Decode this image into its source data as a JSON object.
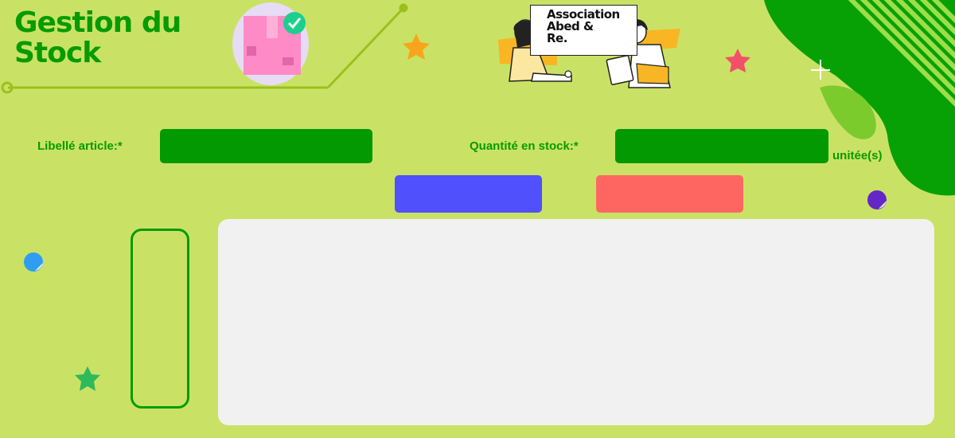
{
  "page": {
    "title": "Gestion du Stock",
    "logo_text": "Association\nAbed &\nRe."
  },
  "form": {
    "libelle_label": "Libellé article:*",
    "libelle_value": "",
    "quantite_label": "Quantité en stock:*",
    "quantite_value": "",
    "unit_label": "unitée(s)"
  },
  "buttons": {
    "primary_label": "",
    "secondary_label": ""
  },
  "colors": {
    "background": "#c9e265",
    "brand_green": "#079b02",
    "field_green": "#029902",
    "button_blue": "#5050fd",
    "button_red": "#fe6662",
    "panel": "#f1f1f1"
  },
  "icons": [
    "box-check-illustration",
    "star-icon",
    "people-illustration",
    "sparkle-icon",
    "blob-decoration"
  ]
}
